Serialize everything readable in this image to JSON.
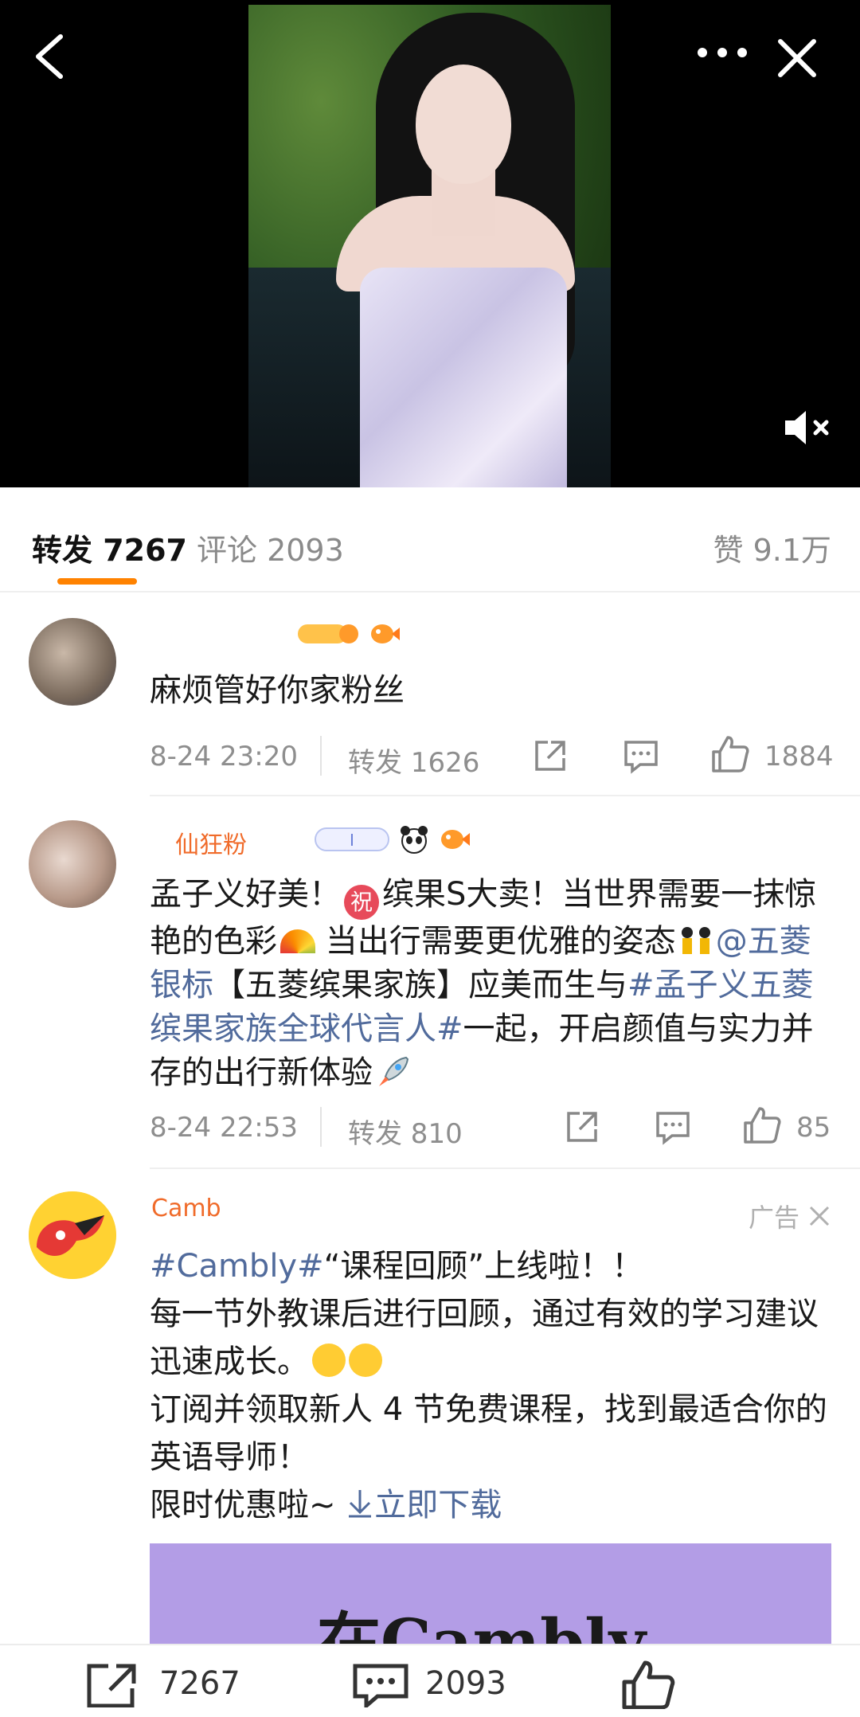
{
  "tabs": {
    "repost": "转发 7267",
    "comment": "评论 2093",
    "like": "赞 9.1万"
  },
  "items": [
    {
      "text": "麻烦管好你家粉丝",
      "time": "8-24 23:20",
      "repost": "转发 1626",
      "likes": "1884"
    },
    {
      "username": "仙狂粉",
      "text_parts": {
        "p1": "孟子义好美！",
        "p2": "缤果S大卖！当世界需要一抹惊艳的色彩",
        "p3": " 当出行需要更优雅的姿态",
        "mention": "@五菱银标",
        "p4": "【五菱缤果家族】应美而生与",
        "hashtag": "#孟子义五菱缤果家族全球代言人#",
        "p5": "一起，开启颜值与实力并存的出行新体验"
      },
      "time": "8-24 22:53",
      "repost": "转发 810",
      "likes": "85"
    },
    {
      "username": "Camb",
      "ad_label": "广告",
      "text_parts": {
        "hashtag": "#Cambly#",
        "p1": "“课程回顾”上线啦！！",
        "p2": "每一节外教课后进行回顾，通过有效的学习建议迅速成长。",
        "p3": "订阅并领取新人 4 节免费课程，找到最适合你的英语导师！",
        "p4": "限时优惠啦~ ",
        "download_link": "立即下载"
      },
      "banner_text": "在Cambly"
    }
  ],
  "bottom_bar": {
    "repost_count": "7267",
    "comment_count": "2093"
  },
  "colors": {
    "accent": "#ff8200",
    "link": "#516b9c",
    "username": "#f06b2a",
    "ad_banner": "#b39de6"
  }
}
